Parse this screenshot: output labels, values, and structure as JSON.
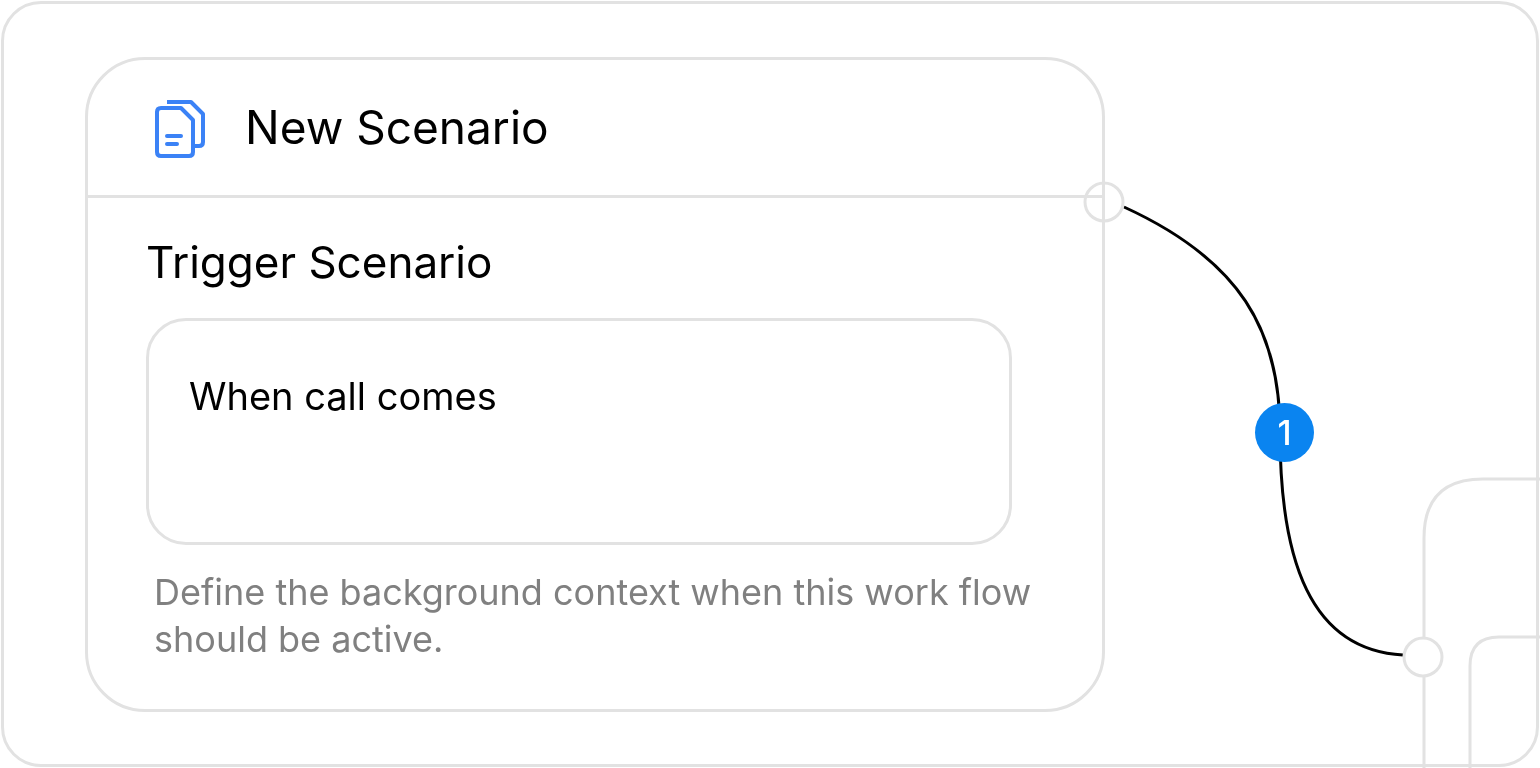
{
  "node": {
    "title": "New Scenario",
    "section_title": "Trigger Scenario",
    "field_value": "When call comes",
    "helper_text": "Define the background context when this work flow should be active."
  },
  "connection": {
    "badge": "1"
  }
}
